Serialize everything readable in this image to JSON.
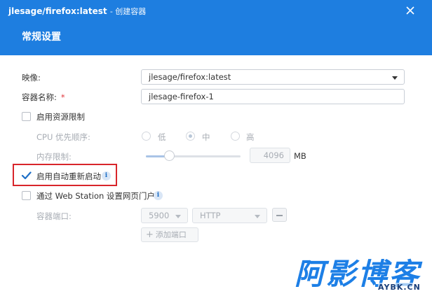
{
  "window": {
    "title_main": "jlesage/firefox:latest",
    "title_sub": "- 创建容器",
    "close_icon": "close-icon"
  },
  "section_title": "常规设置",
  "image": {
    "label": "映像:",
    "value": "jlesage/firefox:latest"
  },
  "container_name": {
    "label": "容器名称:",
    "required_mark": "*",
    "value": "jlesage-firefox-1"
  },
  "resource_limit": {
    "label": "启用资源限制",
    "checked": false
  },
  "cpu_priority": {
    "label": "CPU 优先顺序:",
    "options": [
      {
        "label": "低",
        "selected": false
      },
      {
        "label": "中",
        "selected": true
      },
      {
        "label": "高",
        "selected": false
      }
    ]
  },
  "memory_limit": {
    "label": "内存限制:",
    "value": "4096",
    "unit": "MB"
  },
  "auto_restart": {
    "label": "启用自动重新启动",
    "checked": true,
    "info_icon": "info-icon"
  },
  "web_station": {
    "label": "通过 Web Station 设置网页门户",
    "checked": false,
    "info_icon": "info-icon"
  },
  "container_port": {
    "label": "容器端口:",
    "port": "5900",
    "protocol": "HTTP",
    "add_label": "添加端口"
  },
  "watermark": {
    "main": "阿影博客",
    "sub": "AYBK.CN"
  },
  "colors": {
    "header": "#1e7ee0",
    "accent": "#1e7ee0",
    "highlight_border": "#d8252b",
    "watermark": "#1d7fe6"
  }
}
